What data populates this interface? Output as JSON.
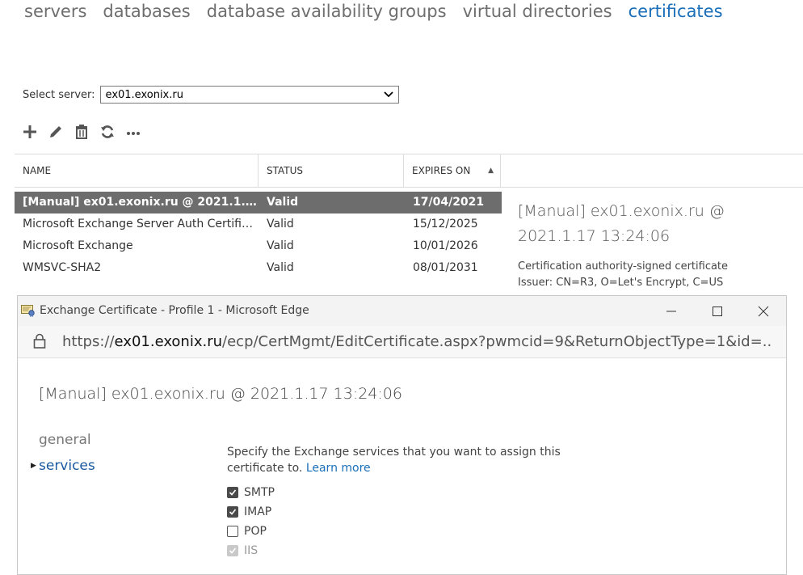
{
  "nav": {
    "items": [
      {
        "label": "servers"
      },
      {
        "label": "databases"
      },
      {
        "label": "database availability groups"
      },
      {
        "label": "virtual directories"
      },
      {
        "label": "certificates",
        "active": true
      }
    ]
  },
  "server": {
    "label": "Select server:",
    "value": "ex01.exonix.ru"
  },
  "toolbar": {
    "icons": [
      "add-icon",
      "edit-icon",
      "delete-icon",
      "refresh-icon",
      "more-icon"
    ]
  },
  "grid": {
    "headers": {
      "name": "NAME",
      "status": "STATUS",
      "expires": "EXPIRES ON"
    },
    "sort": "ascending",
    "rows": [
      {
        "name": "[Manual] ex01.exonix.ru @ 2021.1.17 13:...",
        "status": "Valid",
        "expires": "17/04/2021",
        "selected": true
      },
      {
        "name": "Microsoft Exchange Server Auth Certificate",
        "status": "Valid",
        "expires": "15/12/2025"
      },
      {
        "name": "Microsoft Exchange",
        "status": "Valid",
        "expires": "10/01/2026"
      },
      {
        "name": "WMSVC-SHA2",
        "status": "Valid",
        "expires": "08/01/2031"
      }
    ]
  },
  "details": {
    "title": "[Manual] ex01.exonix.ru @ 2021.1.17 13:24:06",
    "type": "Certification authority-signed certificate",
    "issuer": "Issuer: CN=R3, O=Let's Encrypt, C=US"
  },
  "popup": {
    "window_title": "Exchange Certificate - Profile 1 - Microsoft Edge",
    "url_prefix": "https://",
    "url_host": "ex01.exonix.ru",
    "url_rest": "/ecp/CertMgmt/EditCertificate.aspx?pwmcid=9&ReturnObjectType=1&id=...",
    "cert_title": "[Manual] ex01.exonix.ru @ 2021.1.17 13:24:06",
    "nav": {
      "general": "general",
      "services": "services"
    },
    "instructions": "Specify the Exchange services that you want to assign this certificate to.",
    "learn_more": "Learn more",
    "services": [
      {
        "label": "SMTP",
        "checked": true,
        "disabled": false
      },
      {
        "label": "IMAP",
        "checked": true,
        "disabled": false
      },
      {
        "label": "POP",
        "checked": false,
        "disabled": false
      },
      {
        "label": "IIS",
        "checked": true,
        "disabled": true
      }
    ]
  },
  "colors": {
    "accent": "#1a6fb8",
    "selected_row": "#6d6d6d"
  }
}
